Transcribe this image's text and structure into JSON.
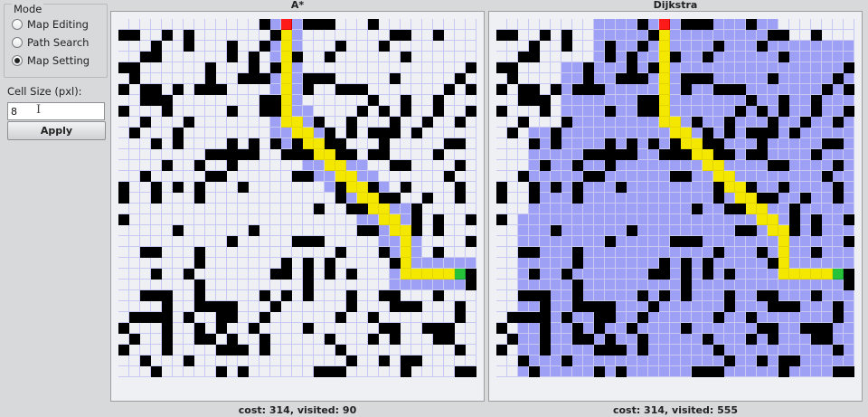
{
  "sidebar": {
    "mode_title": "Mode",
    "modes": [
      {
        "label": "Map Editing",
        "checked": false
      },
      {
        "label": "Path Search",
        "checked": false
      },
      {
        "label": "Map Setting",
        "checked": true
      }
    ],
    "cell_size_label": "Cell Size (pxl):",
    "cell_size_value": "8",
    "apply_label": "Apply"
  },
  "panels": [
    {
      "title": "A*",
      "status": "cost: 314, visited: 90"
    },
    {
      "title": "Dijkstra",
      "status": "cost: 314, visited: 555"
    }
  ],
  "colors": {
    "wall": "#000000",
    "empty": "#eef0f3",
    "visited": "#9ea0f6",
    "path": "#f5e800",
    "start": "#26c23a",
    "target": "#ff1a1a"
  }
}
